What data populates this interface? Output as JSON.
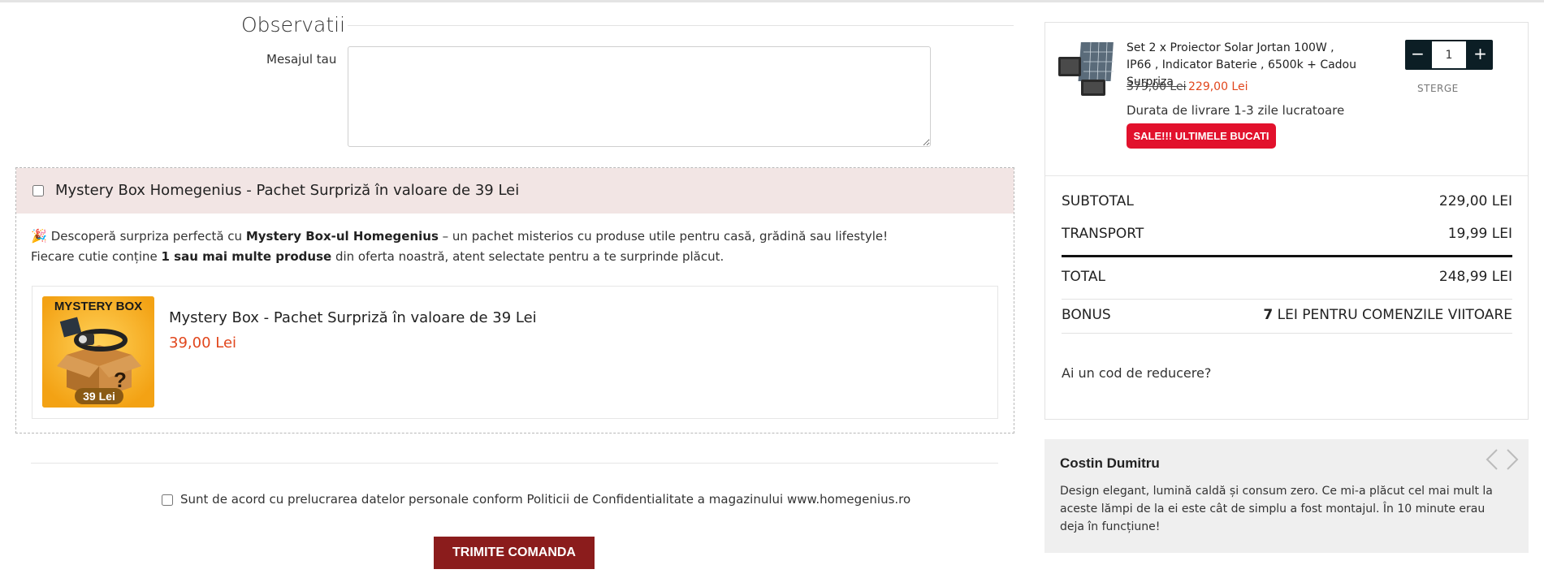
{
  "observatii": {
    "title": "Observatii",
    "message_label": "Mesajul tau",
    "message_value": ""
  },
  "mystery_box": {
    "header_label": "Mystery Box Homegenius - Pachet Surpriză în valoare de 39 Lei",
    "desc_line1_prefix": "Descoperă surpriza perfectă cu ",
    "desc_line1_bold": "Mystery Box-ul Homegenius",
    "desc_line1_suffix": " – un pachet misterios cu produse utile pentru casă, grădină sau lifestyle!",
    "desc_line2_prefix": "Fiecare cutie conține ",
    "desc_line2_bold": "1 sau mai multe produse",
    "desc_line2_suffix": " din oferta noastră, atent selectate pentru a te surprinde plăcut.",
    "emoji": "🎉",
    "image_title": "MYSTERY BOX",
    "image_price": "39 Lei",
    "product_name": "Mystery Box - Pachet Surpriză în valoare de 39 Lei",
    "product_price": "39,00 Lei"
  },
  "agreement": {
    "label": "Sunt de acord cu prelucrarea datelor personale conform Politicii de Confidentialitate a magazinului www.homegenius.ro"
  },
  "submit_label": "TRIMITE COMANDA",
  "cart": {
    "item": {
      "name": "Set 2 x Proiector Solar Jortan 100W , IP66 , Indicator Baterie , 6500k + Cadou Surpriza",
      "price_old": "379,00 Lei",
      "price_new": "229,00 Lei",
      "delivery": "Durata de livrare 1-3 zile lucratoare",
      "badge": "SALE!!! ULTIMELE BUCATI",
      "quantity": "1",
      "minus": "−",
      "plus": "+",
      "remove_label": "STERGE"
    },
    "subtotal_label": "SUBTOTAL",
    "subtotal_value": "229,00 LEI",
    "transport_label": "TRANSPORT",
    "transport_value": "19,99 LEI",
    "total_label": "TOTAL",
    "total_value": "248,99 LEI",
    "bonus_label": "BONUS",
    "bonus_amount": "7",
    "bonus_text": " LEI PENTRU COMENZILE VIITOARE",
    "coupon_link": "Ai un cod de reducere?"
  },
  "review": {
    "author": "Costin Dumitru",
    "text": "Design elegant, lumină caldă și consum zero. Ce mi-a plăcut cel mai mult la aceste lămpi de la ei este cât de simplu a fost montajul. În 10 minute erau deja în funcțiune!"
  },
  "colors": {
    "price_accent": "#e1461c",
    "submit_bg": "#8b1c1c",
    "badge_bg": "#e2112c",
    "qty_bg": "#0c1e25",
    "mystery_header_bg": "#f2e5e4"
  }
}
